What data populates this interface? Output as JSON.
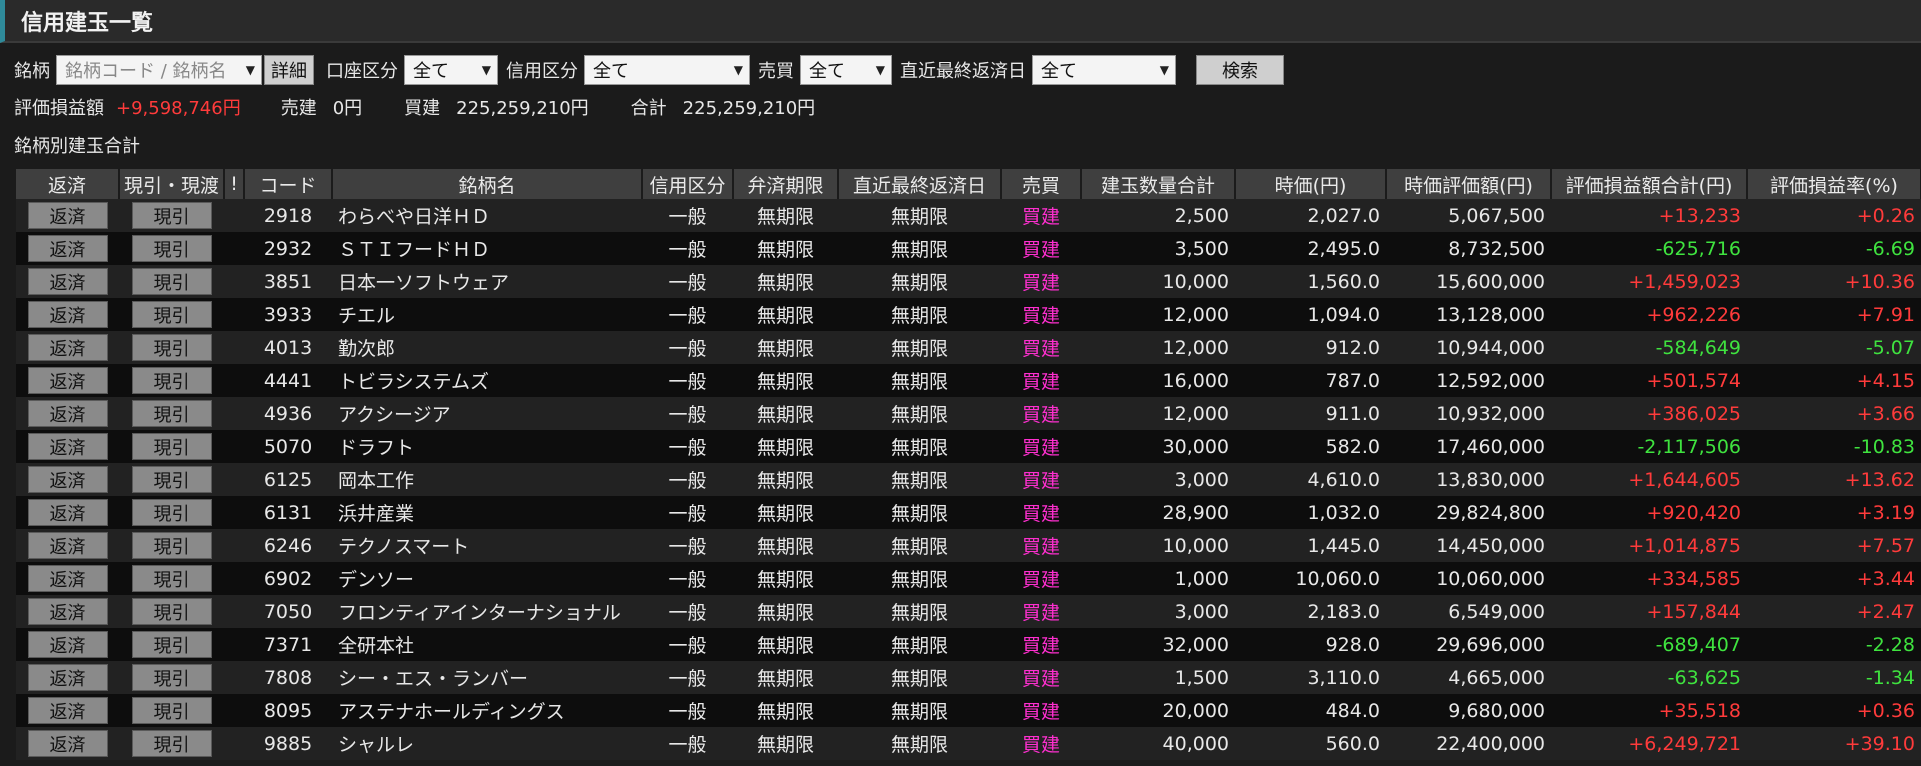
{
  "window": {
    "title": "信用建玉一覧"
  },
  "filters": {
    "brand_label": "銘柄",
    "brand_placeholder": "銘柄コード / 銘柄名",
    "detail_button": "詳細",
    "account_label": "口座区分",
    "account_value": "全て",
    "credit_label": "信用区分",
    "credit_value": "全て",
    "trade_label": "売買",
    "trade_value": "全て",
    "due_label": "直近最終返済日",
    "due_value": "全て",
    "search_button": "検索"
  },
  "summary": {
    "pl_label": "評価損益額",
    "pl_value": "+9,598,746円",
    "sell_label": "売建",
    "sell_value": "0円",
    "buy_label": "買建",
    "buy_value": "225,259,210円",
    "total_label": "合計",
    "total_value": "225,259,210円"
  },
  "section_title": "銘柄別建玉合計",
  "table": {
    "headers": [
      "返済",
      "現引・現渡",
      "!",
      "コード",
      "銘柄名",
      "信用区分",
      "弁済期限",
      "直近最終返済日",
      "売買",
      "建玉数量合計",
      "時価(円)",
      "時価評価額(円)",
      "評価損益額合計(円)",
      "評価損益率(%)"
    ],
    "repay_label": "返済",
    "delivery_label": "現引",
    "rows": [
      {
        "code": "2918",
        "name": "わらべや日洋ＨＤ",
        "credit": "一般",
        "limit": "無期限",
        "due": "無期限",
        "side": "買建",
        "qty": "2,500",
        "price": "2,027.0",
        "value": "5,067,500",
        "pl": "+13,233",
        "rate": "+0.26"
      },
      {
        "code": "2932",
        "name": "ＳＴＩフードＨＤ",
        "credit": "一般",
        "limit": "無期限",
        "due": "無期限",
        "side": "買建",
        "qty": "3,500",
        "price": "2,495.0",
        "value": "8,732,500",
        "pl": "-625,716",
        "rate": "-6.69"
      },
      {
        "code": "3851",
        "name": "日本一ソフトウェア",
        "credit": "一般",
        "limit": "無期限",
        "due": "無期限",
        "side": "買建",
        "qty": "10,000",
        "price": "1,560.0",
        "value": "15,600,000",
        "pl": "+1,459,023",
        "rate": "+10.36"
      },
      {
        "code": "3933",
        "name": "チエル",
        "credit": "一般",
        "limit": "無期限",
        "due": "無期限",
        "side": "買建",
        "qty": "12,000",
        "price": "1,094.0",
        "value": "13,128,000",
        "pl": "+962,226",
        "rate": "+7.91"
      },
      {
        "code": "4013",
        "name": "勤次郎",
        "credit": "一般",
        "limit": "無期限",
        "due": "無期限",
        "side": "買建",
        "qty": "12,000",
        "price": "912.0",
        "value": "10,944,000",
        "pl": "-584,649",
        "rate": "-5.07"
      },
      {
        "code": "4441",
        "name": "トビラシステムズ",
        "credit": "一般",
        "limit": "無期限",
        "due": "無期限",
        "side": "買建",
        "qty": "16,000",
        "price": "787.0",
        "value": "12,592,000",
        "pl": "+501,574",
        "rate": "+4.15"
      },
      {
        "code": "4936",
        "name": "アクシージア",
        "credit": "一般",
        "limit": "無期限",
        "due": "無期限",
        "side": "買建",
        "qty": "12,000",
        "price": "911.0",
        "value": "10,932,000",
        "pl": "+386,025",
        "rate": "+3.66"
      },
      {
        "code": "5070",
        "name": "ドラフト",
        "credit": "一般",
        "limit": "無期限",
        "due": "無期限",
        "side": "買建",
        "qty": "30,000",
        "price": "582.0",
        "value": "17,460,000",
        "pl": "-2,117,506",
        "rate": "-10.83"
      },
      {
        "code": "6125",
        "name": "岡本工作",
        "credit": "一般",
        "limit": "無期限",
        "due": "無期限",
        "side": "買建",
        "qty": "3,000",
        "price": "4,610.0",
        "value": "13,830,000",
        "pl": "+1,644,605",
        "rate": "+13.62"
      },
      {
        "code": "6131",
        "name": "浜井産業",
        "credit": "一般",
        "limit": "無期限",
        "due": "無期限",
        "side": "買建",
        "qty": "28,900",
        "price": "1,032.0",
        "value": "29,824,800",
        "pl": "+920,420",
        "rate": "+3.19"
      },
      {
        "code": "6246",
        "name": "テクノスマート",
        "credit": "一般",
        "limit": "無期限",
        "due": "無期限",
        "side": "買建",
        "qty": "10,000",
        "price": "1,445.0",
        "value": "14,450,000",
        "pl": "+1,014,875",
        "rate": "+7.57"
      },
      {
        "code": "6902",
        "name": "デンソー",
        "credit": "一般",
        "limit": "無期限",
        "due": "無期限",
        "side": "買建",
        "qty": "1,000",
        "price": "10,060.0",
        "value": "10,060,000",
        "pl": "+334,585",
        "rate": "+3.44"
      },
      {
        "code": "7050",
        "name": "フロンティアインターナショナル",
        "credit": "一般",
        "limit": "無期限",
        "due": "無期限",
        "side": "買建",
        "qty": "3,000",
        "price": "2,183.0",
        "value": "6,549,000",
        "pl": "+157,844",
        "rate": "+2.47"
      },
      {
        "code": "7371",
        "name": "全研本社",
        "credit": "一般",
        "limit": "無期限",
        "due": "無期限",
        "side": "買建",
        "qty": "32,000",
        "price": "928.0",
        "value": "29,696,000",
        "pl": "-689,407",
        "rate": "-2.28"
      },
      {
        "code": "7808",
        "name": "シー・エス・ランバー",
        "credit": "一般",
        "limit": "無期限",
        "due": "無期限",
        "side": "買建",
        "qty": "1,500",
        "price": "3,110.0",
        "value": "4,665,000",
        "pl": "-63,625",
        "rate": "-1.34"
      },
      {
        "code": "8095",
        "name": "アステナホールディングス",
        "credit": "一般",
        "limit": "無期限",
        "due": "無期限",
        "side": "買建",
        "qty": "20,000",
        "price": "484.0",
        "value": "9,680,000",
        "pl": "+35,518",
        "rate": "+0.36"
      },
      {
        "code": "9885",
        "name": "シャルレ",
        "credit": "一般",
        "limit": "無期限",
        "due": "無期限",
        "side": "買建",
        "qty": "40,000",
        "price": "560.0",
        "value": "22,400,000",
        "pl": "+6,249,721",
        "rate": "+39.10"
      }
    ]
  },
  "colors": {
    "positive": "#ff3b3b",
    "negative": "#3fe33f",
    "buy": "#ff2fd0",
    "accent": "#2f8a9a"
  }
}
